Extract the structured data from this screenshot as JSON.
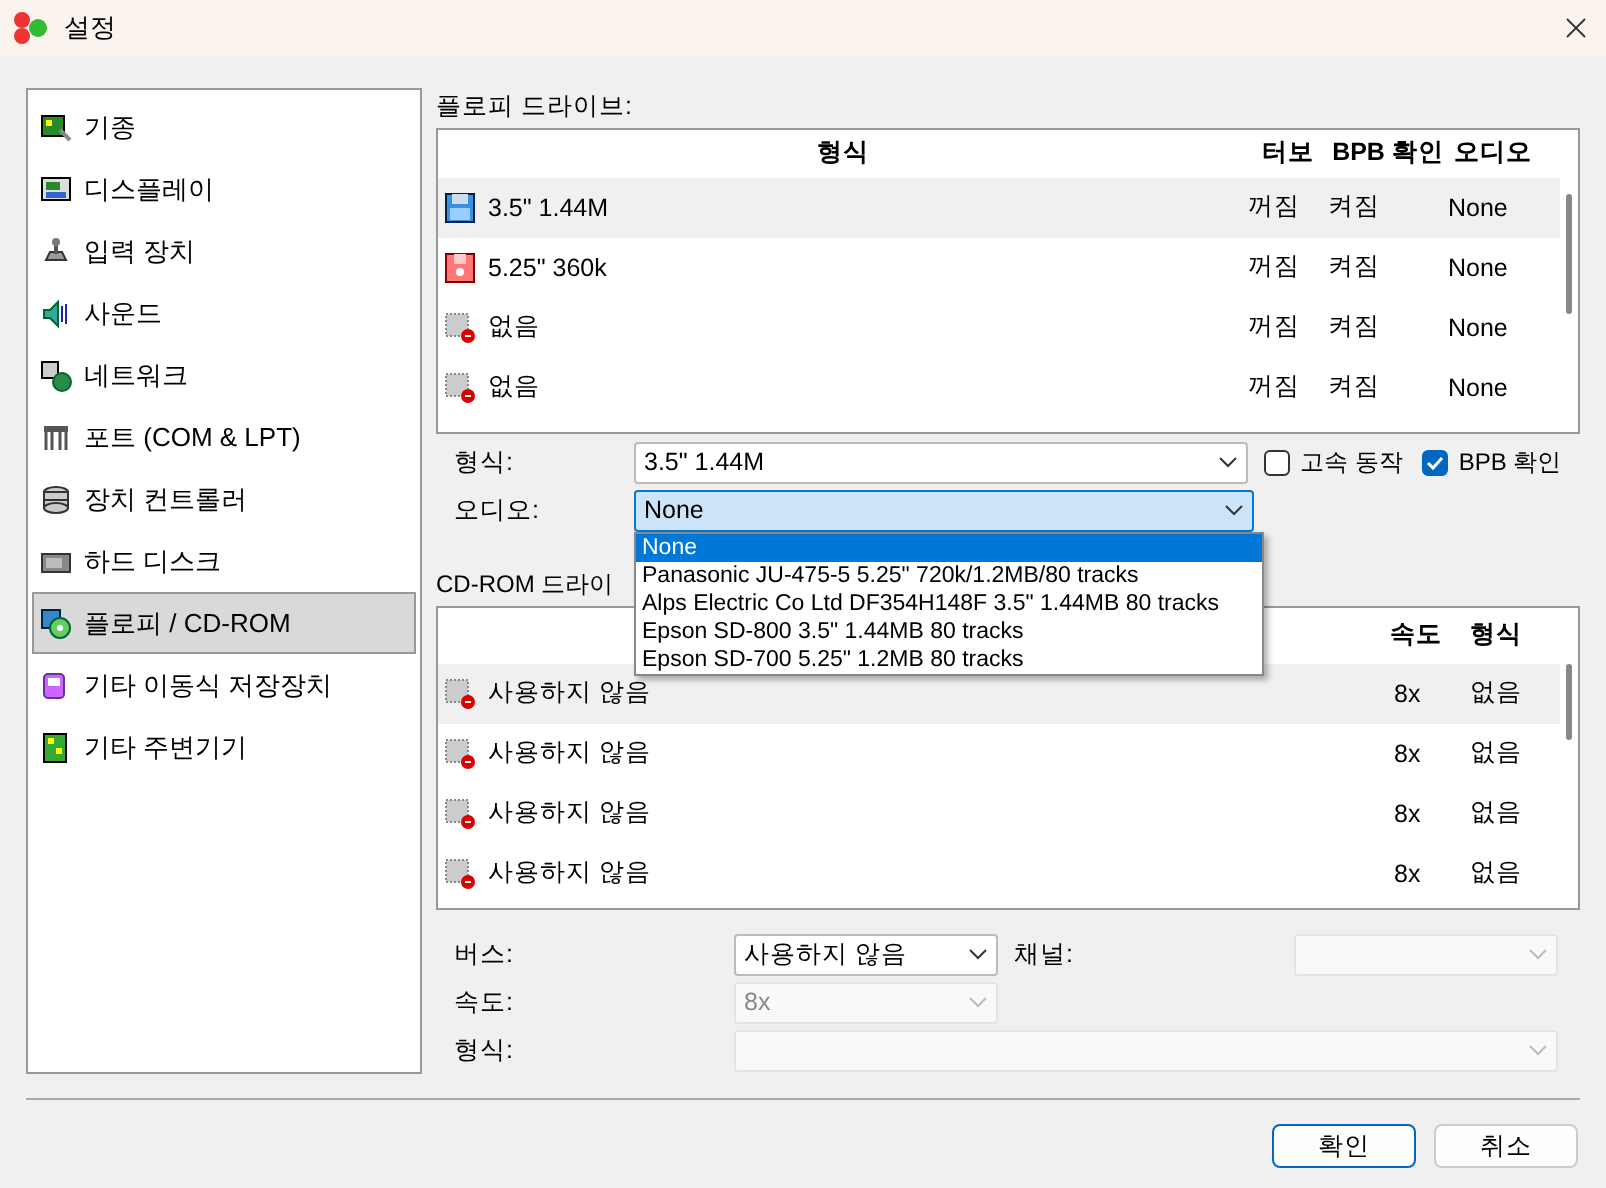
{
  "window": {
    "title": "설정"
  },
  "sidebar": {
    "items": [
      {
        "label": "기종",
        "selected": false
      },
      {
        "label": "디스플레이",
        "selected": false
      },
      {
        "label": "입력 장치",
        "selected": false
      },
      {
        "label": "사운드",
        "selected": false
      },
      {
        "label": "네트워크",
        "selected": false
      },
      {
        "label": "포트 (COM & LPT)",
        "selected": false
      },
      {
        "label": "장치 컨트롤러",
        "selected": false
      },
      {
        "label": "하드 디스크",
        "selected": false
      },
      {
        "label": "플로피 / CD-ROM",
        "selected": true
      },
      {
        "label": "기타 이동식 저장장치",
        "selected": false
      },
      {
        "label": "기타 주변기기",
        "selected": false
      }
    ]
  },
  "floppy": {
    "label": "플로피 드라이브:",
    "columns": [
      "형식",
      "터보",
      "BPB 확인",
      "오디오"
    ],
    "rows": [
      {
        "type": "3.5\" 1.44M",
        "turbo": "꺼짐",
        "bpb": "켜짐",
        "audio": "None",
        "selected": true
      },
      {
        "type": "5.25\" 360k",
        "turbo": "꺼짐",
        "bpb": "켜짐",
        "audio": "None",
        "selected": false
      },
      {
        "type": "없음",
        "turbo": "꺼짐",
        "bpb": "켜짐",
        "audio": "None",
        "selected": false
      },
      {
        "type": "없음",
        "turbo": "꺼짐",
        "bpb": "켜짐",
        "audio": "None",
        "selected": false
      }
    ],
    "type_label": "형식:",
    "type_value": "3.5\" 1.44M",
    "turbo_checkbox": {
      "label": "고속 동작",
      "checked": false
    },
    "bpb_checkbox": {
      "label": "BPB 확인",
      "checked": true
    },
    "audio_label": "오디오:",
    "audio_value": "None",
    "audio_options": [
      {
        "label": "None",
        "selected": true
      },
      {
        "label": "Panasonic JU-475-5 5.25\" 720k/1.2MB/80 tracks",
        "selected": false
      },
      {
        "label": "Alps Electric Co Ltd DF354H148F 3.5\" 1.44MB 80 tracks",
        "selected": false
      },
      {
        "label": "Epson SD-800 3.5\" 1.44MB 80 tracks",
        "selected": false
      },
      {
        "label": "Epson SD-700 5.25\" 1.2MB 80 tracks",
        "selected": false
      }
    ]
  },
  "cdrom": {
    "label": "CD-ROM 드라이",
    "columns": [
      "속도",
      "형식"
    ],
    "rows": [
      {
        "bus": "사용하지 않음",
        "speed": "8x",
        "type": "없음",
        "selected": true
      },
      {
        "bus": "사용하지 않음",
        "speed": "8x",
        "type": "없음",
        "selected": false
      },
      {
        "bus": "사용하지 않음",
        "speed": "8x",
        "type": "없음",
        "selected": false
      },
      {
        "bus": "사용하지 않음",
        "speed": "8x",
        "type": "없음",
        "selected": false
      }
    ],
    "bus_label": "버스:",
    "bus_value": "사용하지 않음",
    "bus_disabled": false,
    "channel_label": "채널:",
    "channel_disabled": true,
    "speed_label": "속도:",
    "speed_value": "8x",
    "speed_disabled": true,
    "type_label": "형식:",
    "type_disabled": true
  },
  "buttons": [
    {
      "label": "확인",
      "default": true
    },
    {
      "label": "취소",
      "default": false
    }
  ]
}
